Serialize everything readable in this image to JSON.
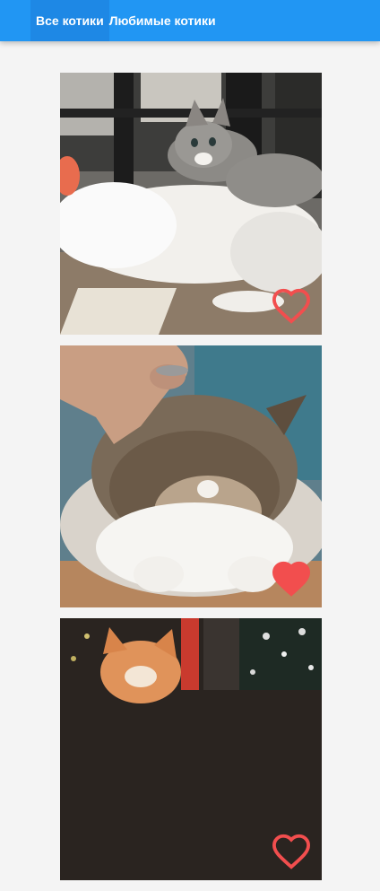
{
  "nav": {
    "tabs": [
      {
        "label": "Все котики",
        "active": true
      },
      {
        "label": "Любимые котики",
        "active": false
      }
    ]
  },
  "colors": {
    "header": "#2196f3",
    "active_tab": "#1e88e5",
    "heart": "#f24e4e",
    "background": "#f4f4f4"
  },
  "cats": [
    {
      "photo": "grey kitten lying on white cat by window",
      "favorite": false
    },
    {
      "photo": "tabby-and-white scottish fold cat being petted",
      "favorite": true
    },
    {
      "photo": "ginger kitten near christmas tree",
      "favorite": false
    }
  ]
}
